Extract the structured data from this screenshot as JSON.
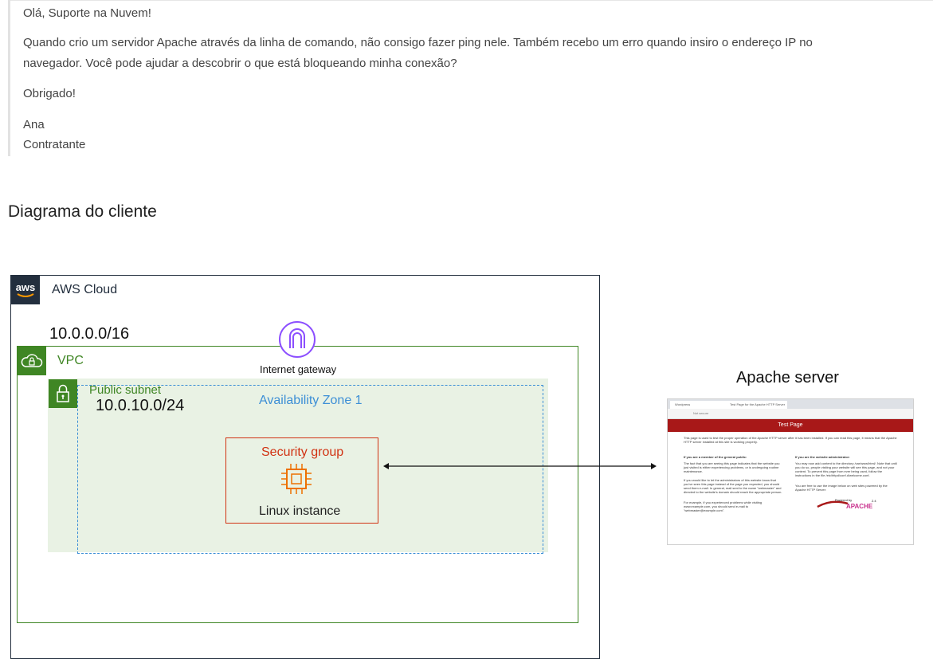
{
  "message": {
    "greeting": "Olá, Suporte na Nuvem!",
    "body_line1": "Quando crio um servidor Apache através da linha de comando, não consigo fazer ping nele. Também recebo um erro quando insiro o endereço IP no",
    "body_line2": "navegador. Você pode ajudar a descobrir o que está bloqueando minha conexão?",
    "thanks": "Obrigado!",
    "name": "Ana",
    "role": "Contratante"
  },
  "section_title": "Diagrama do cliente",
  "diagram": {
    "aws_cloud_label": "AWS Cloud",
    "aws_logo_text": "aws",
    "vpc_cidr": "10.0.0.0/16",
    "vpc_label": "VPC",
    "internet_gateway_label": "Internet gateway",
    "subnet_label": "Public subnet",
    "subnet_cidr": "10.0.10.0/24",
    "az_label": "Availability Zone 1",
    "security_group_label": "Security group",
    "instance_label": "Linux instance",
    "apache_server_label": "Apache server",
    "colors": {
      "aws_dark": "#232f3e",
      "vpc_green": "#3f8624",
      "az_blue": "#3d8fd6",
      "security_red": "#d13212",
      "gateway_purple": "#8c4fff",
      "compute_orange": "#ed7100"
    }
  },
  "browser": {
    "tab1": "Wordpress",
    "tab2": "Test Page for the Apache HTTP Server",
    "address": "Not secure",
    "header": "Test Page",
    "intro": "This page is used to test the proper operation of the Apache HTTP server after it has been installed. If you can read this page, it means that the Apache HTTP server installed at this site is working properly.",
    "public_heading": "If you are a member of the general public:",
    "public_text1": "The fact that you are seeing this page indicates that the website you just visited is either experiencing problems, or is undergoing routine maintenance.",
    "public_text2": "If you would like to let the administrators of this website know that you've seen this page instead of the page you expected, you should send them e-mail. In general, mail sent to the name \"webmaster\" and directed to the website's domain should reach the appropriate person.",
    "public_text3": "For example, if you experienced problems while visiting www.example.com, you should send e-mail to \"webmaster@example.com\".",
    "admin_heading": "If you are the website administrator:",
    "admin_text1": "You may now add content to the directory /var/www/html/. Note that until you do so, people visiting your website will see this page, and not your content. To prevent this page from ever being used, follow the instructions in the file /etc/httpd/conf.d/welcome.conf.",
    "admin_text2": "You are free to use the image below on web sites powered by the Apache HTTP Server:",
    "powered_by": "Powered by",
    "apache_version": "2.4",
    "apache_logo": "APACHE"
  }
}
